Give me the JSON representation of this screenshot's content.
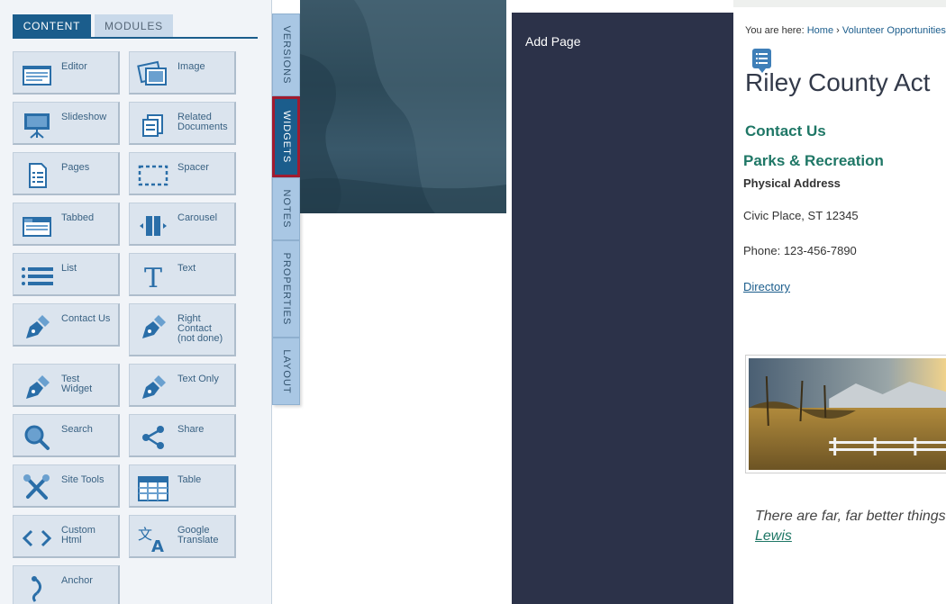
{
  "panel": {
    "tabs": [
      {
        "label": "CONTENT",
        "active": true
      },
      {
        "label": "MODULES",
        "active": false
      }
    ],
    "widgets": [
      {
        "label": "Editor",
        "icon": "editor-icon"
      },
      {
        "label": "Image",
        "icon": "image-icon"
      },
      {
        "label": "Slideshow",
        "icon": "slideshow-icon"
      },
      {
        "label": "Related\nDocuments",
        "icon": "related-documents-icon"
      },
      {
        "label": "Pages",
        "icon": "pages-icon"
      },
      {
        "label": "Spacer",
        "icon": "spacer-icon"
      },
      {
        "label": "Tabbed",
        "icon": "tabbed-icon"
      },
      {
        "label": "Carousel",
        "icon": "carousel-icon"
      },
      {
        "label": "List",
        "icon": "list-icon"
      },
      {
        "label": "Text",
        "icon": "text-icon"
      },
      {
        "label": "Contact Us",
        "icon": "pen-icon"
      },
      {
        "label": "Right\nContact\n(not done)",
        "icon": "pen-icon"
      },
      {
        "label": "Test\nWidget",
        "icon": "pen-icon"
      },
      {
        "label": "Text Only",
        "icon": "pen-icon"
      },
      {
        "label": "Search",
        "icon": "search-icon"
      },
      {
        "label": "Share",
        "icon": "share-icon"
      },
      {
        "label": "Site Tools",
        "icon": "tools-icon"
      },
      {
        "label": "Table",
        "icon": "table-icon"
      },
      {
        "label": "Custom\nHtml",
        "icon": "code-icon"
      },
      {
        "label": "Google\nTranslate",
        "icon": "translate-icon"
      },
      {
        "label": "Anchor",
        "icon": "anchor-icon"
      }
    ]
  },
  "side_tabs": [
    {
      "label": "VERSIONS",
      "active": false
    },
    {
      "label": "WIDGETS",
      "active": true
    },
    {
      "label": "NOTES",
      "active": false
    },
    {
      "label": "PROPERTIES",
      "active": false
    },
    {
      "label": "LAYOUT",
      "active": false
    }
  ],
  "nav": {
    "add_page": "Add Page"
  },
  "page": {
    "breadcrumb": {
      "prefix": "You are here:",
      "home": "Home",
      "separator": "›",
      "current": "Volunteer Opportunities"
    },
    "title": "Riley County Act",
    "contact_heading": "Contact Us",
    "dept_heading": "Parks & Recreation",
    "address_label": "Physical Address",
    "address_line": "Civic Place, ST 12345",
    "phone": "Phone: 123-456-7890",
    "directory_link": "Directory",
    "quote_text": "There are far, far better things a",
    "quote_author": "Lewis"
  },
  "colors": {
    "accent": "#1b5d8c",
    "nav_bg": "#2c3249",
    "heading_green": "#1f7766",
    "active_outline": "#a01b2f",
    "tile_bg": "#dbe4ee"
  }
}
